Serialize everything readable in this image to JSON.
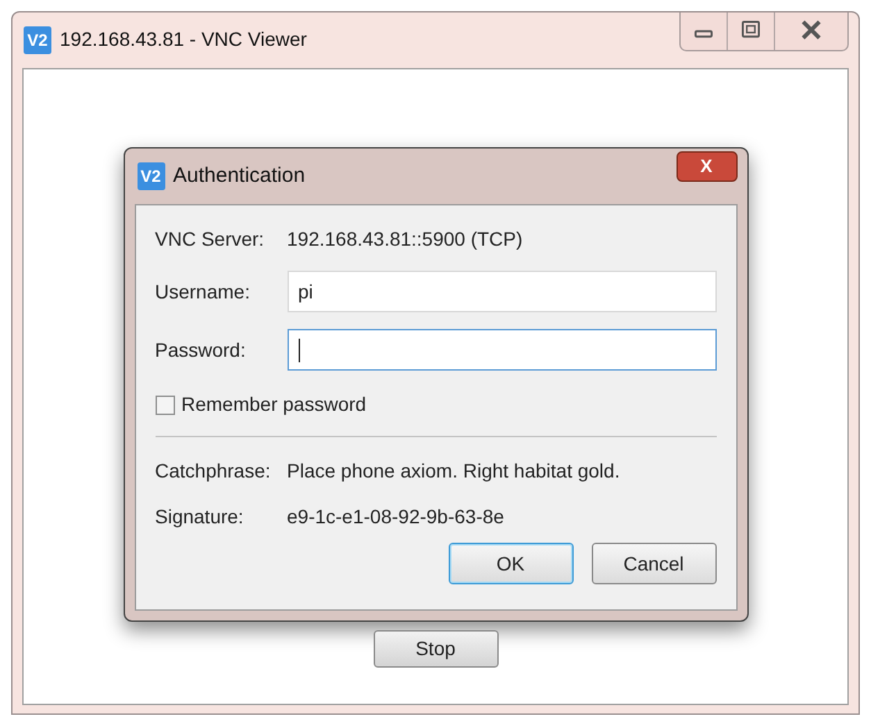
{
  "window": {
    "logo_text": "V2",
    "title": "192.168.43.81 - VNC Viewer"
  },
  "dialog": {
    "logo_text": "V2",
    "title": "Authentication",
    "close_label": "X",
    "server": {
      "label": "VNC Server:",
      "value": "192.168.43.81::5900 (TCP)"
    },
    "username": {
      "label": "Username:",
      "value": "pi"
    },
    "password": {
      "label": "Password:",
      "focused": true
    },
    "remember": {
      "label": "Remember password",
      "checked": false
    },
    "catchphrase": {
      "label": "Catchphrase:",
      "value": "Place phone axiom. Right habitat gold."
    },
    "signature": {
      "label": "Signature:",
      "value": "e9-1c-e1-08-92-9b-63-8e"
    },
    "buttons": [
      {
        "label": "OK",
        "default": true
      },
      {
        "label": "Cancel",
        "default": false
      }
    ]
  },
  "stop_button": {
    "label": "Stop"
  }
}
